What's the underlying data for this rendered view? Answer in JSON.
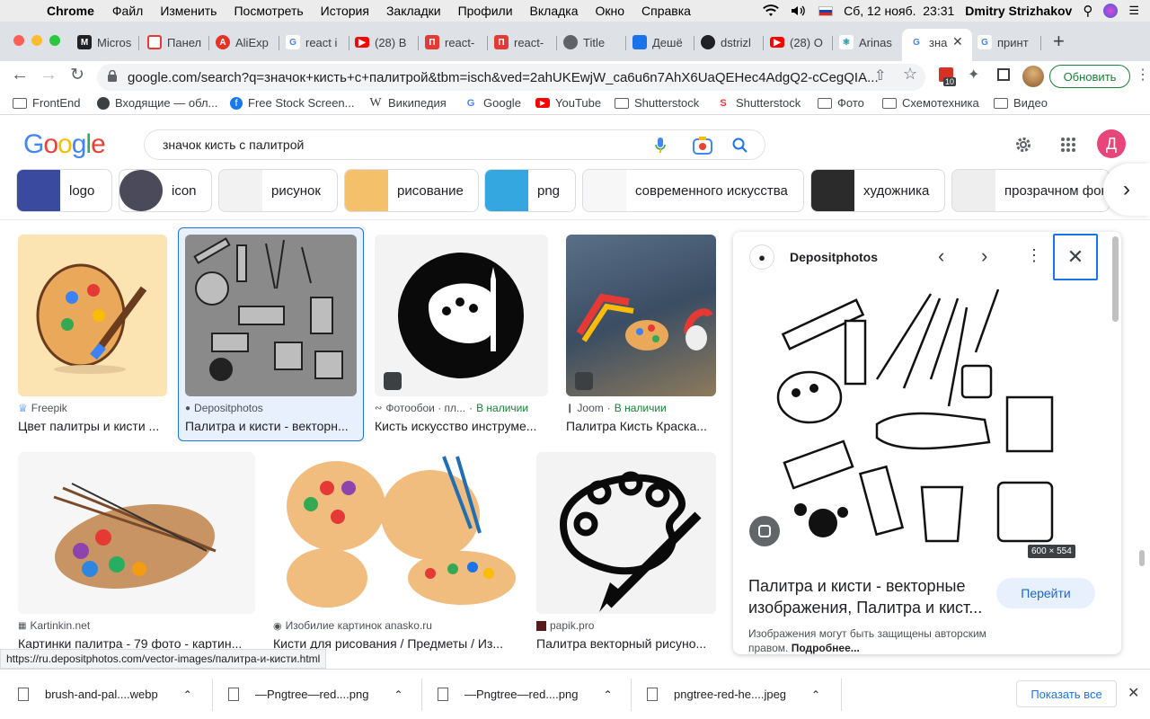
{
  "menubar": {
    "app": "Chrome",
    "items": [
      "Файл",
      "Изменить",
      "Посмотреть",
      "История",
      "Закладки",
      "Профили",
      "Вкладка",
      "Окно",
      "Справка"
    ],
    "datetime": "Сб, 12 нояб.  23:31",
    "user": "Dmitry Strizhakov"
  },
  "tabs": [
    "Micros",
    "Панел",
    "AliExp",
    "react i",
    "(28) B",
    "react-",
    "react-",
    "Title",
    "Дешё",
    "dstrizl",
    "(28) O",
    "Arinas",
    "зна",
    "принт"
  ],
  "toolbar": {
    "url": "google.com/search?q=значок+кисть+с+палитрой&tbm=isch&ved=2ahUKEwjW_ca6u6n7AhX6UaQEHec4AdgQ2-cCegQIA...",
    "ext_badge": "10",
    "update_label": "Обновить"
  },
  "bookmarks": [
    "FrontEnd",
    "Входящие — обл...",
    "Free Stock Screen...",
    "Википедия",
    "Google",
    "YouTube",
    "Shutterstock",
    "Shutterstock",
    "Фото",
    "Схемотехника",
    "Видео"
  ],
  "google": {
    "query": "значок кисть с палитрой",
    "avatar": "Д"
  },
  "chips": [
    "logo",
    "icon",
    "рисунок",
    "рисование",
    "png",
    "современного искусства",
    "художника",
    "прозрачном фон"
  ],
  "results": [
    {
      "source": "Freepik",
      "title": "Цвет палитры и кисти ...",
      "stock": ""
    },
    {
      "source": "Depositphotos",
      "title": "Палитра и кисти - векторн...",
      "stock": ""
    },
    {
      "source": "Фотообои · пл...",
      "title": "Кисть искусство инструме...",
      "stock": "В наличии"
    },
    {
      "source": "Joom",
      "title": "Палитра Кисть Краска...",
      "stock": "В наличии"
    },
    {
      "source": "Kartinkin.net",
      "title": "Картинки палитра - 79 фото - картин...",
      "stock": ""
    },
    {
      "source": "Изобилие картинок anasko.ru",
      "title": "Кисти для рисования / Предметы / Из...",
      "stock": ""
    },
    {
      "source": "papik.pro",
      "title": "Палитра векторный рисуно...",
      "stock": ""
    }
  ],
  "panel": {
    "source": "Depositphotos",
    "dimensions": "600 × 554",
    "title": "Палитра и кисти - векторные изображения, Палитра и кист...",
    "visit_label": "Перейти",
    "copyright": "Изображения могут быть защищены авторским правом.",
    "more_label": "Подробнее..."
  },
  "status_url": "https://ru.depositphotos.com/vector-images/палитра-и-кисти.html",
  "downloads": [
    "brush-and-pal....webp",
    "—Pngtree—red....png",
    "—Pngtree—red....png",
    "pngtree-red-he....jpeg"
  ],
  "show_all_label": "Показать все"
}
